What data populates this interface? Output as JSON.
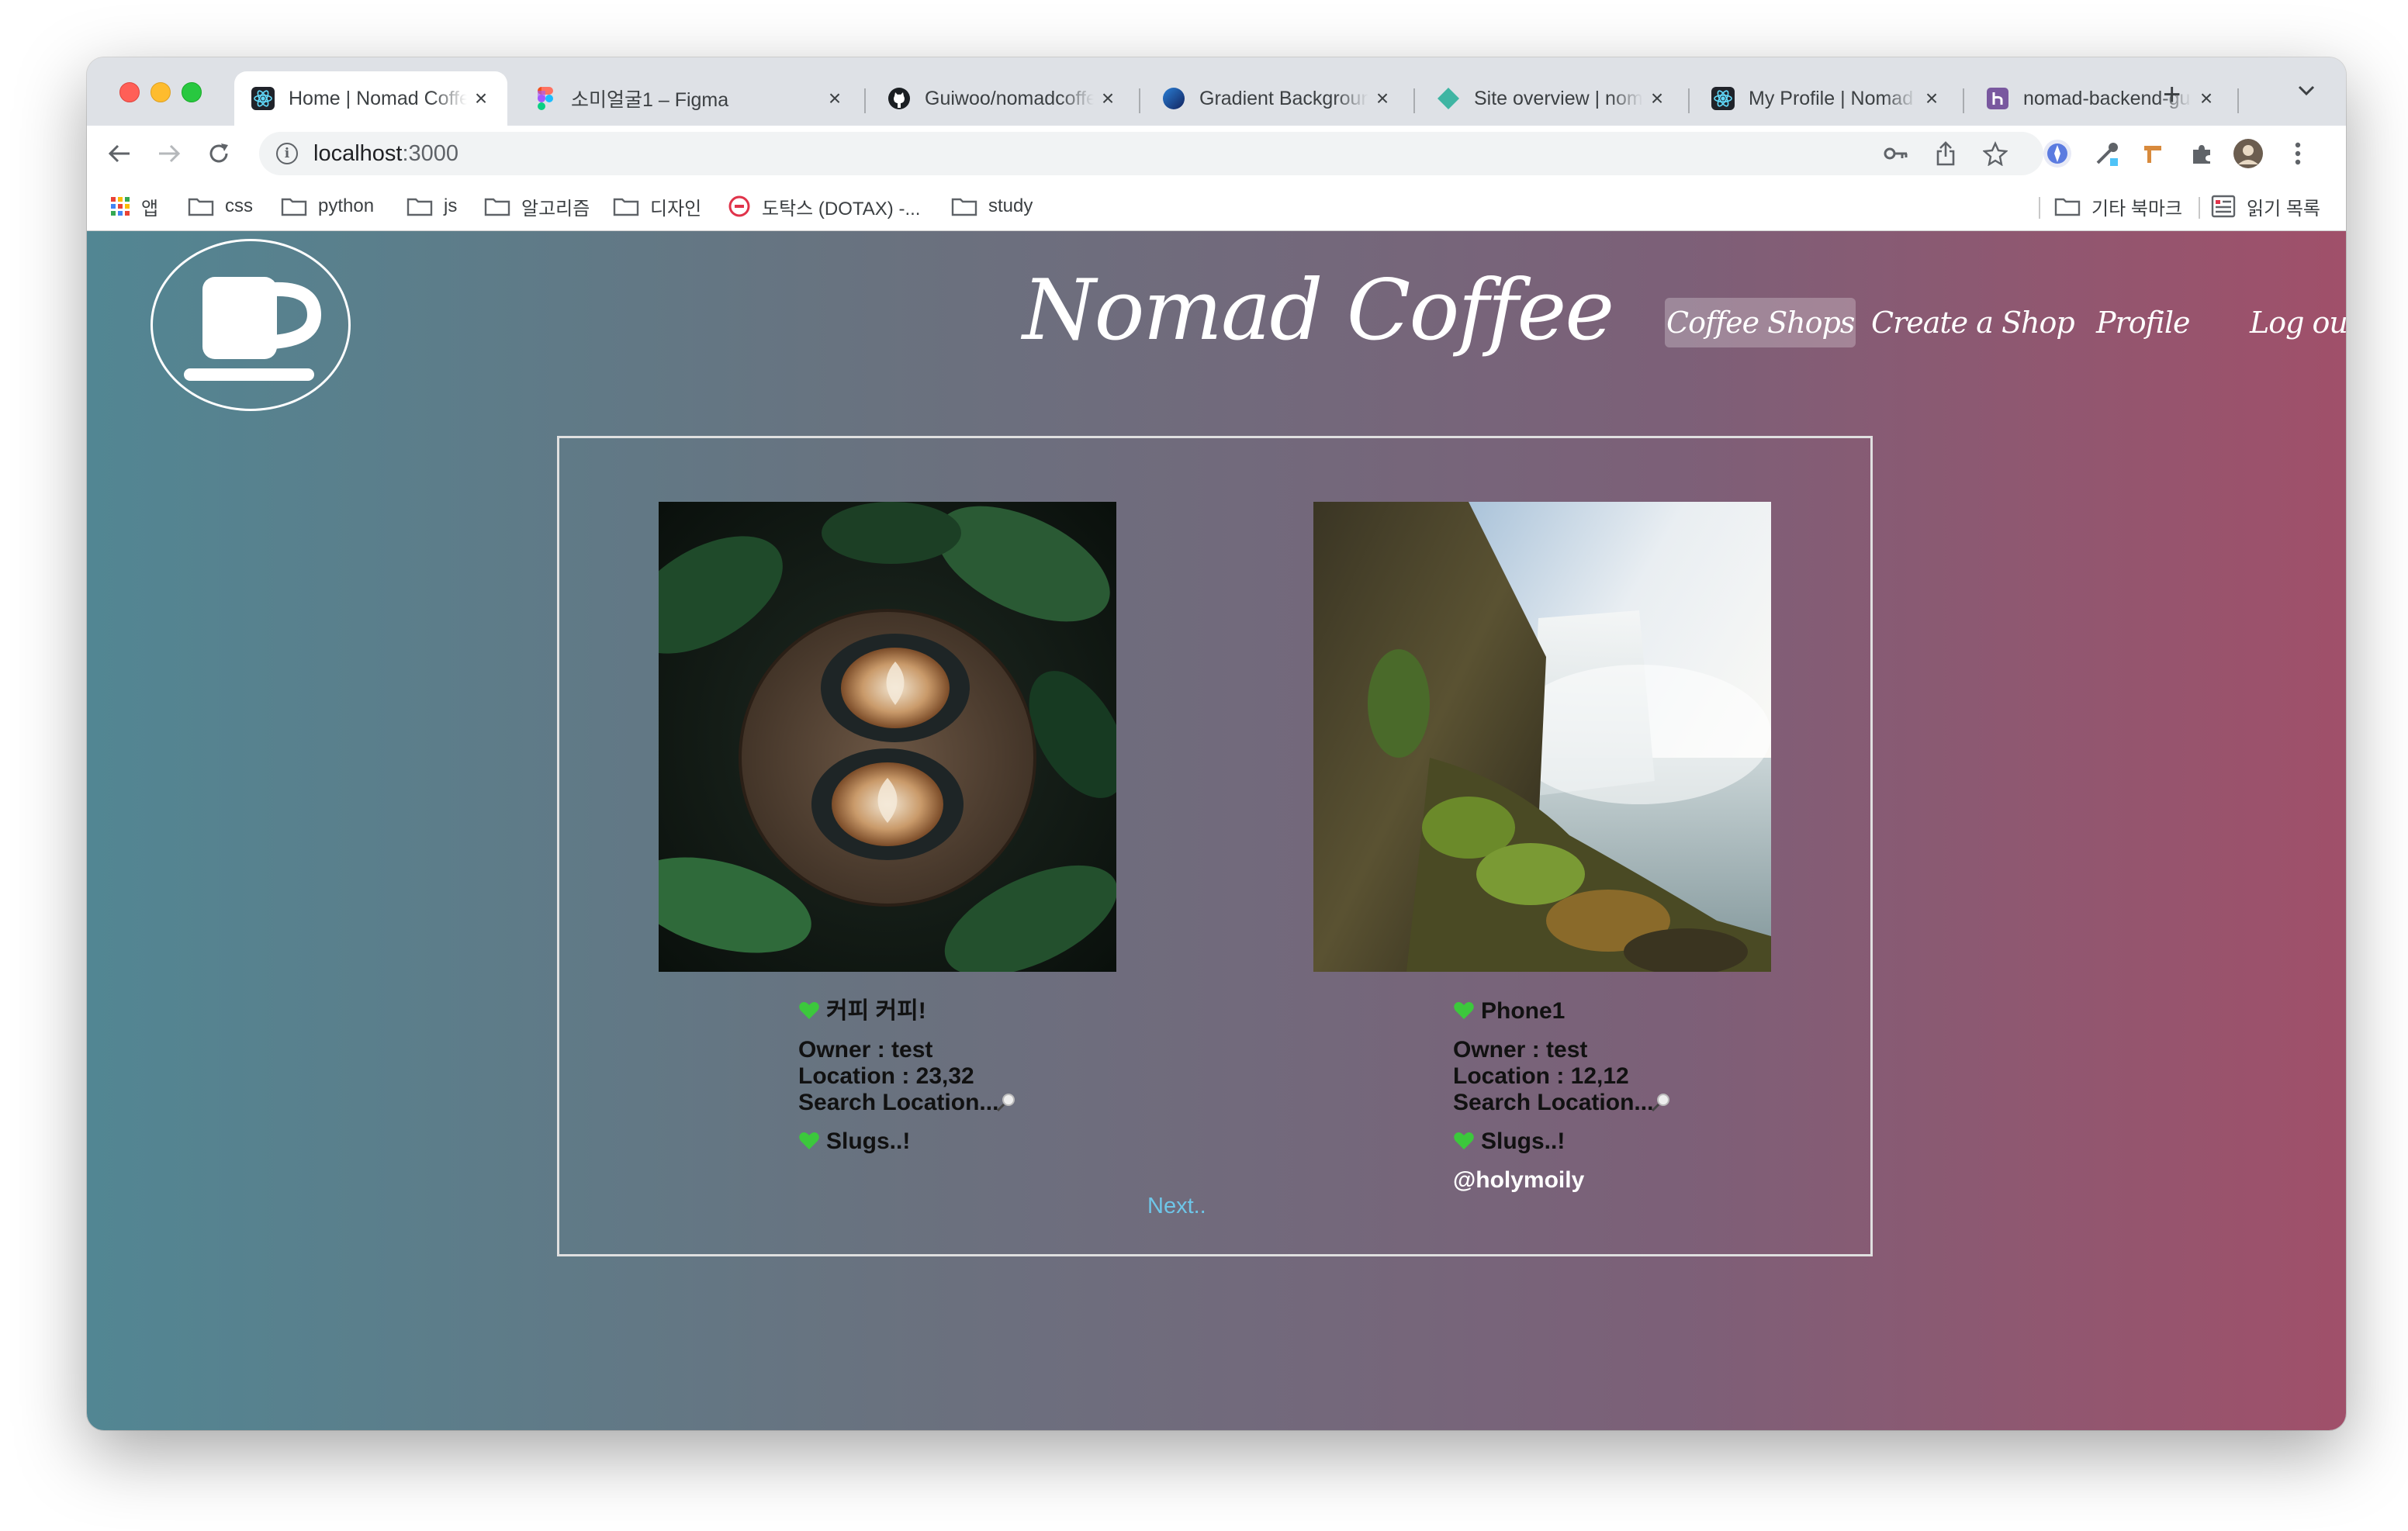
{
  "tabs": [
    {
      "title": "Home | Nomad Coffee",
      "active": true,
      "favicon": "react-icon"
    },
    {
      "title": "소미얼굴1 – Figma",
      "active": false,
      "favicon": "figma-icon"
    },
    {
      "title": "Guiwoo/nomadcoffee",
      "active": false,
      "favicon": "github-icon"
    },
    {
      "title": "Gradient Background",
      "active": false,
      "favicon": "gradient-icon"
    },
    {
      "title": "Site overview | nomad",
      "active": false,
      "favicon": "netlify-icon"
    },
    {
      "title": "My Profile | Nomad",
      "active": false,
      "favicon": "react-icon"
    },
    {
      "title": "nomad-backend-gu",
      "active": false,
      "favicon": "heroku-icon"
    }
  ],
  "address": {
    "host": "localhost",
    "port": ":3000"
  },
  "bookmarks": [
    {
      "label": "앱",
      "icon": "apps-grid-icon"
    },
    {
      "label": "css",
      "icon": "folder-icon"
    },
    {
      "label": "python",
      "icon": "folder-icon"
    },
    {
      "label": "js",
      "icon": "folder-icon"
    },
    {
      "label": "알고리즘",
      "icon": "folder-icon"
    },
    {
      "label": "디자인",
      "icon": "folder-icon"
    },
    {
      "label": "도탁스 (DOTAX) -...",
      "icon": "dotax-icon"
    },
    {
      "label": "study",
      "icon": "folder-icon"
    }
  ],
  "bookmarks_right": [
    {
      "label": "기타 북마크",
      "icon": "folder-icon"
    },
    {
      "label": "읽기 목록",
      "icon": "reading-list-icon"
    }
  ],
  "site": {
    "title": "Nomad Coffee",
    "nav": [
      "Coffee Shops",
      "Create a Shop",
      "Profile",
      "Log out"
    ],
    "active_nav": "Coffee Shops"
  },
  "shops": [
    {
      "name": "커피 커피!",
      "owner": "Owner : test",
      "location": "Location : 23,32",
      "search": "Search Location...",
      "category": "Slugs..!",
      "author": "",
      "photo": "latte-art-coffee-photo"
    },
    {
      "name": "Phone1",
      "owner": "Owner : test",
      "location": "Location : 12,12",
      "search": "Search Location...",
      "category": "Slugs..!",
      "author": "@holymoily",
      "photo": "waterfall-cliff-photo"
    }
  ],
  "pagination": {
    "next_label": "Next.."
  },
  "colors": {
    "gradient_left": "#528693",
    "gradient_right": "#a0506a",
    "heart": "#3cc83c",
    "next_link": "#6ec6e8"
  }
}
